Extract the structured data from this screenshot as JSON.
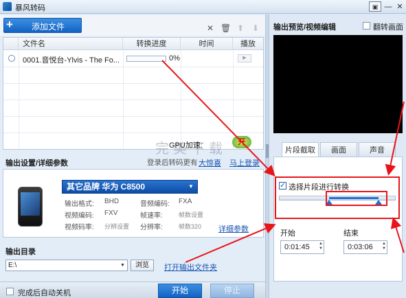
{
  "window": {
    "title": "暴风转码"
  },
  "toolbar": {
    "add_label": "添加文件"
  },
  "file_table": {
    "columns": [
      "文件名",
      "转换进度",
      "时间",
      "播放"
    ],
    "rows": [
      {
        "name": "0001.音悦台-Ylvis - The Fo...",
        "progress_text": "0%",
        "progress": 0,
        "time": ""
      }
    ]
  },
  "gpu": {
    "label": "GPU加速:",
    "badge": "开",
    "watermark": "完美下载"
  },
  "output_settings": {
    "title": "输出设置/详细参数",
    "login_text": "登录后转码更有",
    "surprise_link": "大惊喜",
    "login_link": "马上登录",
    "device": "其它品牌  华为  C8500",
    "params": {
      "format_label": "输出格式:",
      "format_value": "BHD",
      "audio_codec_label": "音频编码:",
      "audio_codec_value": "FXA",
      "video_codec_label": "视频编码:",
      "video_codec_value": "FXV",
      "framerate_label": "帧速率:",
      "framerate_value": "帧数设置",
      "video_bitrate_label": "视频码率:",
      "video_bitrate_value": "分辨设置",
      "resolution_label": "分辨率:",
      "resolution_value": "帧数320"
    },
    "detail_link": "详细参数"
  },
  "output_dir": {
    "title": "输出目录",
    "path": "E:\\",
    "browse": "浏览",
    "open_link": "打开输出文件夹"
  },
  "bottom": {
    "shutdown_label": "完成后自动关机",
    "start": "开始",
    "stop": "停止"
  },
  "preview": {
    "title": "输出预览/视频编辑",
    "flip_label": "翻转画面"
  },
  "edit_tabs": [
    "片段截取",
    "画面",
    "声音"
  ],
  "clip": {
    "segment_label": "选择片段进行转换",
    "segment_checked": true,
    "range_start": 0.43,
    "range_end": 0.86,
    "start_label": "开始",
    "start_time": "0:01:45",
    "end_label": "结束",
    "end_time": "0:03:06"
  },
  "colors": {
    "accent": "#1263c4",
    "annotation": "#e8141a"
  }
}
